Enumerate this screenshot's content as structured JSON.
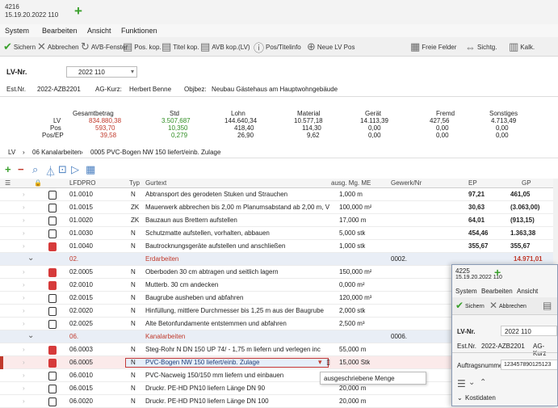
{
  "window": {
    "line1": "4216",
    "line2": "15.19.20.2022 110",
    "tab_add": "+"
  },
  "menu": [
    "System",
    "Bearbeiten",
    "Ansicht",
    "Funktionen"
  ],
  "toolbar": [
    {
      "icon": "check-icon",
      "label": "Sichern"
    },
    {
      "icon": "cross-icon",
      "label": "Abbrechen"
    },
    {
      "icon": "refresh-icon",
      "label": "AVB-Fenster"
    },
    {
      "icon": "document-icon",
      "label": "Pos. kop."
    },
    {
      "icon": "document-icon",
      "label": "Titel kop."
    },
    {
      "icon": "document-icon",
      "label": "AVB kop.(LV)"
    },
    {
      "icon": "info-icon",
      "label": "Pos/Titelinfo"
    },
    {
      "icon": "add-icon",
      "label": "Neue LV Pos"
    },
    {
      "icon": "sheet-icon",
      "label": "Freie Felder"
    },
    {
      "icon": "arrows-icon",
      "label": "Sichtg."
    },
    {
      "icon": "grid-icon",
      "label": "Kalk."
    }
  ],
  "lv": {
    "label": "LV-Nr.",
    "value": "2022 110"
  },
  "estimate": {
    "label": "Est.Nr.",
    "number": "2022-AZB2201",
    "ag_label": "AG-Kurz:",
    "ag_value": "Herbert Benne",
    "obj_label": "Objbez:",
    "obj_value": "Neubau Gästehaus am Hauptwohngebäude"
  },
  "summary": {
    "headers": [
      "Gesamtbetrag",
      "Std",
      "Lohn",
      "Material",
      "Gerät",
      "Fremd",
      "Sonstiges"
    ],
    "row_labels": [
      "LV",
      "Pos",
      "Pos/EP"
    ],
    "rows": [
      [
        "834.880,38",
        "3.507,687",
        "144.640,34",
        "10.577,18",
        "14.113,39",
        "427,56",
        "4.713,49"
      ],
      [
        "593,70",
        "10,350",
        "418,40",
        "114,30",
        "0,00",
        "0,00",
        "0,00"
      ],
      [
        "39,58",
        "0,279",
        "26,90",
        "9,62",
        "0,00",
        "0,00",
        "0,00"
      ]
    ]
  },
  "breadcrumb": [
    "LV",
    "06 Kanalarbeiten",
    "0005 PVC-Bogen NW 150 liefert/einb. Zulage"
  ],
  "grid": {
    "headers": [
      "LFDPRO",
      "Typ",
      "Gurtext",
      "ausg. Mg. ME",
      "Gewerk/Nr",
      "EP",
      "GP"
    ],
    "rows": [
      {
        "kind": "item",
        "lock": "open",
        "nr": "01.0010",
        "typ": "N",
        "text": "Abtransport des gerodeten Stuken und Strauchen",
        "menge": "1,000 m",
        "gew": "",
        "ep": "97,21",
        "gp": "461,05"
      },
      {
        "kind": "item",
        "lock": "open",
        "nr": "01.0015",
        "typ": "ZK",
        "text": "Mauerwerk abbrechen bis 2,00 m Planumsabstand ab 2,00 m, Verb",
        "menge": "100,000 m²",
        "gew": "",
        "ep": "30,63",
        "gp": "(3.063,00)"
      },
      {
        "kind": "item",
        "lock": "open",
        "nr": "01.0020",
        "typ": "ZK",
        "text": "Bauzaun aus Brettern aufstellen",
        "menge": "17,000 m",
        "gew": "",
        "ep": "64,01",
        "gp": "(913,15)"
      },
      {
        "kind": "item",
        "lock": "open",
        "nr": "01.0030",
        "typ": "N",
        "text": "Schutzmatte aufstellen, vorhalten, abbauen",
        "menge": "5,000 stk",
        "gew": "",
        "ep": "454,46",
        "gp": "1.363,38"
      },
      {
        "kind": "item",
        "lock": "red",
        "nr": "01.0040",
        "typ": "N",
        "text": "Bautrocknungsgeräte aufstellen und anschließen",
        "menge": "1,000 stk",
        "gew": "",
        "ep": "355,67",
        "gp": "355,67"
      },
      {
        "kind": "title",
        "nr": "02.",
        "text": "Erdarbeiten",
        "gew": "0002.",
        "gp": "14.971,01"
      },
      {
        "kind": "item",
        "lock": "red",
        "nr": "02.0005",
        "typ": "N",
        "text": "Oberboden 30 cm abtragen und seitlich lagern",
        "menge": "150,000 m²",
        "gew": "",
        "ep": "",
        "gp": ""
      },
      {
        "kind": "item",
        "lock": "red",
        "nr": "02.0010",
        "typ": "N",
        "text": "Mutterb. 30 cm andecken",
        "menge": "0,000 m²",
        "gew": "",
        "ep": "",
        "gp": ""
      },
      {
        "kind": "item",
        "lock": "open",
        "nr": "02.0015",
        "typ": "N",
        "text": "Baugrube ausheben und abfahren",
        "menge": "120,000 m³",
        "gew": "",
        "ep": "",
        "gp": ""
      },
      {
        "kind": "item",
        "lock": "open",
        "nr": "02.0020",
        "typ": "N",
        "text": "Hinfüllung, mittlere Durchmesser bis 1,25 m aus der Baugrube",
        "menge": "2,000 stk",
        "gew": "",
        "ep": "",
        "gp": ""
      },
      {
        "kind": "item",
        "lock": "open",
        "nr": "02.0025",
        "typ": "N",
        "text": "Alte Betonfundamente entstemmen und abfahren",
        "menge": "2,500 m³",
        "gew": "",
        "ep": "",
        "gp": ""
      },
      {
        "kind": "title",
        "nr": "06.",
        "text": "Kanalarbeiten",
        "gew": "0006.",
        "gp": ""
      },
      {
        "kind": "item",
        "lock": "red",
        "nr": "06.0003",
        "typ": "N",
        "text": "Steg-Rohr N DN 150 UP 74/ - 1,75 m liefern und verlegen inc",
        "menge": "55,000 m",
        "gew": "",
        "ep": "",
        "gp": ""
      },
      {
        "kind": "sel",
        "lock": "red",
        "nr": "06.0005",
        "typ": "N",
        "text": "PVC-Bogen NW 150 liefert/einb. Zulage",
        "menge": "15,000 Stk",
        "gew": "",
        "ep": "",
        "gp": ""
      },
      {
        "kind": "item",
        "lock": "open",
        "nr": "06.0010",
        "typ": "N",
        "text": "PVC-Nacweig 150/150 mm liefern und einbauen",
        "menge": "15,000 stk",
        "gew": "",
        "ep": "",
        "gp": ""
      },
      {
        "kind": "item",
        "lock": "open",
        "nr": "06.0015",
        "typ": "N",
        "text": "Druckr. PE-HD PN10 liefern Länge DN 90",
        "menge": "20,000 m",
        "gew": "",
        "ep": "",
        "gp": ""
      },
      {
        "kind": "item",
        "lock": "open",
        "nr": "06.0020",
        "typ": "N",
        "text": "Druckr. PE-HD PN10 liefern Länge DN 100",
        "menge": "20,000 m",
        "gew": "",
        "ep": "",
        "gp": ""
      }
    ]
  },
  "tooltip": "ausgeschriebene Menge",
  "popup": {
    "title1": "4225",
    "title2": "15.19.20.2022 110",
    "menu": [
      "System",
      "Bearbeiten",
      "Ansicht"
    ],
    "save": "Sichern",
    "cancel": "Abbrechen",
    "lv_label": "LV-Nr.",
    "lv_value": "2022 110",
    "est_label": "Est.Nr.",
    "est_value": "2022-AZB2201",
    "ag_label": "AG-Kurz",
    "list_label": "Auftragsnummer",
    "list_value": "123457890125123",
    "node": "Kostidaten"
  },
  "colors": {
    "accent_green": "#3aa02c",
    "accent_red": "#c0392b",
    "accent_blue": "#4a7fc0"
  }
}
